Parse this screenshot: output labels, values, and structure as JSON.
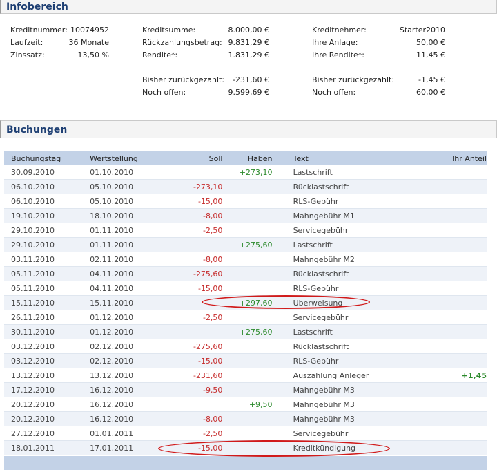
{
  "info": {
    "title": "Infobereich",
    "col1": [
      {
        "label": "Kreditnummer:",
        "value": "10074952"
      },
      {
        "label": "Laufzeit:",
        "value": "36 Monate"
      },
      {
        "label": "Zinssatz:",
        "value": "13,50 %"
      }
    ],
    "col2": [
      {
        "label": "Kreditsumme:",
        "value": "8.000,00 €"
      },
      {
        "label": "Rückzahlungsbetrag:",
        "value": "9.831,29 €"
      },
      {
        "label": "Rendite*:",
        "value": "1.831,29 €"
      },
      {
        "label": "Bisher zurückgezahlt:",
        "value": "-231,60 €"
      },
      {
        "label": "Noch offen:",
        "value": "9.599,69 €"
      }
    ],
    "col3": [
      {
        "label": "Kreditnehmer:",
        "value": "Starter2010"
      },
      {
        "label": "Ihre Anlage:",
        "value": "50,00 €"
      },
      {
        "label": "Ihre Rendite*:",
        "value": "11,45 €"
      },
      {
        "label": "Bisher zurückgezahlt:",
        "value": "-1,45 €"
      },
      {
        "label": "Noch offen:",
        "value": "60,00 €"
      }
    ]
  },
  "buchungen": {
    "title": "Buchungen",
    "headers": {
      "buchungstag": "Buchungstag",
      "wertstellung": "Wertstellung",
      "soll": "Soll",
      "haben": "Haben",
      "text": "Text",
      "anteil": "Ihr Anteil"
    },
    "rows": [
      {
        "buchungstag": "30.09.2010",
        "wertstellung": "01.10.2010",
        "soll": "",
        "haben": "+273,10",
        "text": "Lastschrift",
        "anteil": ""
      },
      {
        "buchungstag": "06.10.2010",
        "wertstellung": "05.10.2010",
        "soll": "-273,10",
        "haben": "",
        "text": "Rücklastschrift",
        "anteil": ""
      },
      {
        "buchungstag": "06.10.2010",
        "wertstellung": "05.10.2010",
        "soll": "-15,00",
        "haben": "",
        "text": "RLS-Gebühr",
        "anteil": ""
      },
      {
        "buchungstag": "19.10.2010",
        "wertstellung": "18.10.2010",
        "soll": "-8,00",
        "haben": "",
        "text": "Mahngebühr M1",
        "anteil": ""
      },
      {
        "buchungstag": "29.10.2010",
        "wertstellung": "01.11.2010",
        "soll": "-2,50",
        "haben": "",
        "text": "Servicegebühr",
        "anteil": ""
      },
      {
        "buchungstag": "29.10.2010",
        "wertstellung": "01.11.2010",
        "soll": "",
        "haben": "+275,60",
        "text": "Lastschrift",
        "anteil": ""
      },
      {
        "buchungstag": "03.11.2010",
        "wertstellung": "02.11.2010",
        "soll": "-8,00",
        "haben": "",
        "text": "Mahngebühr M2",
        "anteil": ""
      },
      {
        "buchungstag": "05.11.2010",
        "wertstellung": "04.11.2010",
        "soll": "-275,60",
        "haben": "",
        "text": "Rücklastschrift",
        "anteil": ""
      },
      {
        "buchungstag": "05.11.2010",
        "wertstellung": "04.11.2010",
        "soll": "-15,00",
        "haben": "",
        "text": "RLS-Gebühr",
        "anteil": ""
      },
      {
        "buchungstag": "15.11.2010",
        "wertstellung": "15.11.2010",
        "soll": "",
        "haben": "+297,60",
        "text": "Überweisung",
        "anteil": ""
      },
      {
        "buchungstag": "26.11.2010",
        "wertstellung": "01.12.2010",
        "soll": "-2,50",
        "haben": "",
        "text": "Servicegebühr",
        "anteil": ""
      },
      {
        "buchungstag": "30.11.2010",
        "wertstellung": "01.12.2010",
        "soll": "",
        "haben": "+275,60",
        "text": "Lastschrift",
        "anteil": ""
      },
      {
        "buchungstag": "03.12.2010",
        "wertstellung": "02.12.2010",
        "soll": "-275,60",
        "haben": "",
        "text": "Rücklastschrift",
        "anteil": ""
      },
      {
        "buchungstag": "03.12.2010",
        "wertstellung": "02.12.2010",
        "soll": "-15,00",
        "haben": "",
        "text": "RLS-Gebühr",
        "anteil": ""
      },
      {
        "buchungstag": "13.12.2010",
        "wertstellung": "13.12.2010",
        "soll": "-231,60",
        "haben": "",
        "text": "Auszahlung Anleger",
        "anteil": "+1,45"
      },
      {
        "buchungstag": "17.12.2010",
        "wertstellung": "16.12.2010",
        "soll": "-9,50",
        "haben": "",
        "text": "Mahngebühr M3",
        "anteil": ""
      },
      {
        "buchungstag": "20.12.2010",
        "wertstellung": "16.12.2010",
        "soll": "",
        "haben": "+9,50",
        "text": "Mahngebühr M3",
        "anteil": ""
      },
      {
        "buchungstag": "20.12.2010",
        "wertstellung": "16.12.2010",
        "soll": "-8,00",
        "haben": "",
        "text": "Mahngebühr M3",
        "anteil": ""
      },
      {
        "buchungstag": "27.12.2010",
        "wertstellung": "01.01.2011",
        "soll": "-2,50",
        "haben": "",
        "text": "Servicegebühr",
        "anteil": ""
      },
      {
        "buchungstag": "18.01.2011",
        "wertstellung": "17.01.2011",
        "soll": "-15,00",
        "haben": "",
        "text": "Kreditkündigung",
        "anteil": ""
      }
    ]
  },
  "colors": {
    "header_text": "#1e3f73",
    "table_header_bg": "#c3d2e7",
    "negative": "#c62b2b",
    "positive": "#2c8a2c",
    "annotation": "#d11a1a"
  }
}
